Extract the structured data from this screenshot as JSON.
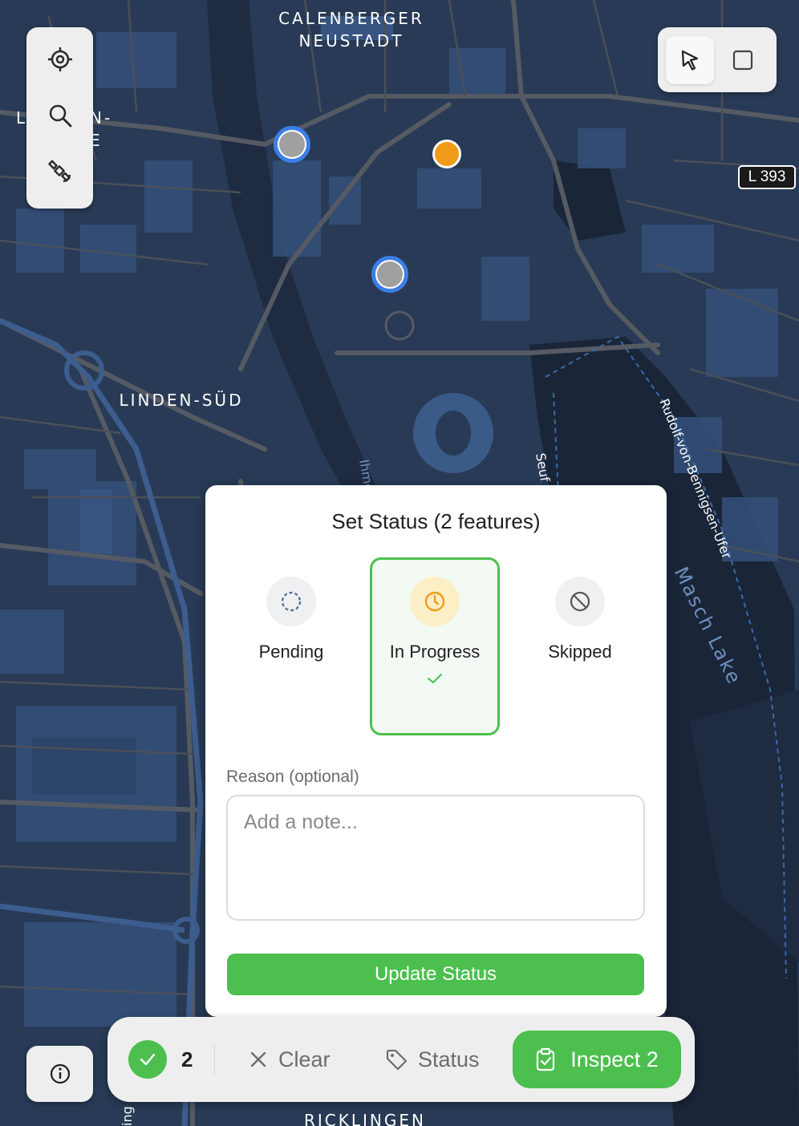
{
  "map": {
    "labels": {
      "calenberger_1": "CALENBERGER",
      "calenberger_2": "NEUSTADT",
      "linden_sud": "LINDEN-SÜD",
      "rudolf": "Rudolf-von-Bennigsen-Ufer",
      "masch_lake": "Masch Lake",
      "ricklingen": "RICKLINGEN",
      "seuf": "Seuf",
      "ihme": "Ihme",
      "partial_l": "L",
      "partial_n": "N-",
      "partial_e": "E",
      "partial_ing": "ing"
    },
    "road_badge": "L 393",
    "colors": {
      "water": "#1a2538",
      "land": "#283a55",
      "buildings": "#34507a",
      "roads": "#555a63"
    }
  },
  "left_toolbar": {
    "items": [
      {
        "icon": "locate-icon"
      },
      {
        "icon": "search-icon"
      },
      {
        "icon": "satellite-icon"
      }
    ]
  },
  "right_toolbar": {
    "items": [
      {
        "icon": "pointer-icon",
        "active": true
      },
      {
        "icon": "square-select-icon",
        "active": false
      }
    ]
  },
  "status_dialog": {
    "title": "Set Status (2 features)",
    "options": [
      {
        "label": "Pending",
        "icon": "dashed-circle-icon",
        "selected": false
      },
      {
        "label": "In Progress",
        "icon": "clock-icon",
        "selected": true
      },
      {
        "label": "Skipped",
        "icon": "ban-icon",
        "selected": false
      }
    ],
    "reason_label": "Reason (optional)",
    "note_placeholder": "Add a note...",
    "note_value": "",
    "submit_label": "Update Status"
  },
  "bottom_bar": {
    "selected_count": "2",
    "clear_label": "Clear",
    "status_label": "Status",
    "inspect_label": "Inspect 2"
  },
  "accent_color": "#4cbf4f"
}
